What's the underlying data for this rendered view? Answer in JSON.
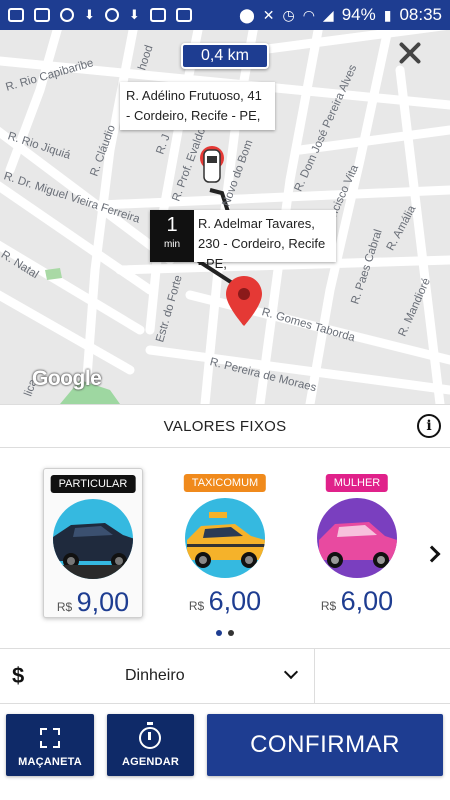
{
  "status_bar": {
    "battery": "94%",
    "time": "08:35"
  },
  "map": {
    "distance": "0,4 km",
    "origin_address": "R. Adélino Frutuoso, 41 - Cordeiro, Recife - PE,",
    "destination_address": "R. Adelmar Tavares, 230 - Cordeiro, Recife - PE,",
    "eta_value": "1",
    "eta_unit": "min",
    "logo": "Google",
    "streets": [
      "R. Rio Capibaribe",
      "R. Rio Jiquiá",
      "R. Dr. Miguel Vieira Ferreira",
      "R. Natal",
      "R. Cláudio",
      "R. J",
      "R. Prof. Evaldo",
      "Novo do Bom",
      "R. Dom José Pereira Alves",
      "Francisco Vita",
      "R. Amália",
      "R. Paes Cabral",
      "R. Mandioré",
      "R. Gomes Taborda",
      "R. Pereira de Moraes",
      "Estr. do Forte",
      "hood",
      "lica"
    ]
  },
  "fixed_values": {
    "title": "VALORES FIXOS",
    "info_icon": "info-icon"
  },
  "categories": [
    {
      "badge": "PARTICULAR",
      "badge_color": "#111111",
      "currency": "R$",
      "price": "9,00",
      "selected": true,
      "car_color": "#1f2a3d",
      "circle_color": "#35b9e0"
    },
    {
      "badge": "TAXICOMUM",
      "badge_color": "#f08a1c",
      "currency": "R$",
      "price": "6,00",
      "selected": false,
      "car_color": "#f5b22a",
      "circle_color": "#35b9e0"
    },
    {
      "badge": "MULHER",
      "badge_color": "#e0218a",
      "currency": "R$",
      "price": "6,00",
      "selected": false,
      "car_color": "#e84aa0",
      "circle_color": "#7a3fbf"
    }
  ],
  "pager": {
    "pages": 2,
    "active": 0
  },
  "payment": {
    "icon": "dollar-icon",
    "symbol": "$",
    "method": "Dinheiro"
  },
  "actions": {
    "handle_label": "MAÇANETA",
    "schedule_label": "AGENDAR",
    "confirm_label": "CONFIRMAR"
  },
  "colors": {
    "primary": "#1e3d91",
    "dark_button": "#0f2a68",
    "pin_red": "#e53935"
  }
}
